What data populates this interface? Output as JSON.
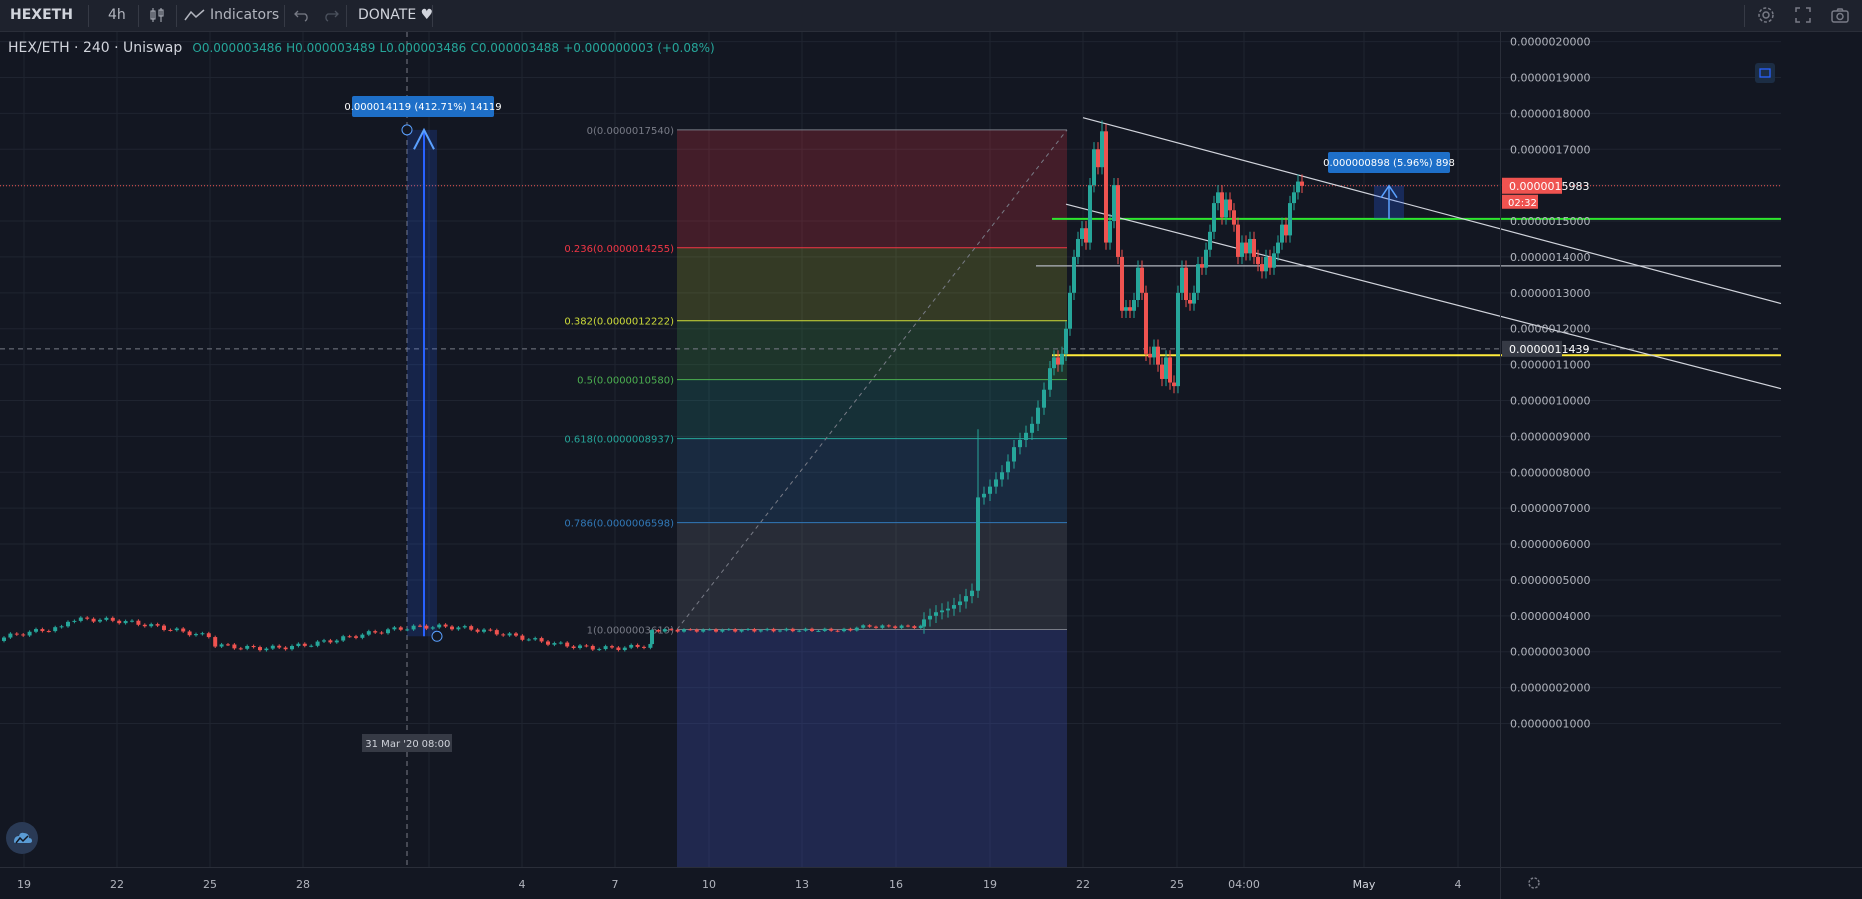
{
  "toolbar": {
    "symbol": "HEXETH",
    "interval": "4h",
    "indicators_label": "Indicators",
    "donate_label": "DONATE ♥",
    "undo_icon": "undo-icon",
    "redo_icon": "redo-icon",
    "settings_icon": "gear-icon",
    "fullscreen_icon": "fullscreen-icon",
    "snapshot_icon": "camera-icon"
  },
  "legend": {
    "title": "HEX/ETH · 240 · Uniswap",
    "open": "O0.000003486",
    "high": "H0.000003489",
    "low": "L0.000003486",
    "close": "C0.000003488",
    "change": "+0.000000003 (+0.08%)"
  },
  "price_axis": {
    "ticks": [
      "0.0000020000",
      "0.0000019000",
      "0.0000018000",
      "0.0000017000",
      "0.0000015000",
      "0.0000014000",
      "0.0000013000",
      "0.0000012000",
      "0.0000011000",
      "0.0000010000",
      "0.0000009000",
      "0.0000008000",
      "0.0000007000",
      "0.0000006000",
      "0.0000005000",
      "0.0000004000",
      "0.0000003000",
      "0.0000002000",
      "0.0000001000"
    ],
    "last_price": "0.0000015983",
    "countdown": "02:32",
    "crosshair_price": "0.0000011439"
  },
  "time_axis": {
    "ticks": [
      "19",
      "22",
      "25",
      "28",
      "4",
      "7",
      "10",
      "13",
      "16",
      "19",
      "22",
      "25",
      "04:00",
      "May",
      "4"
    ],
    "crosshair_date": "31 Mar '20",
    "crosshair_time": "08:00"
  },
  "measure_big": {
    "label": "0.000014119 (412.71%) 14119"
  },
  "measure_small": {
    "label": "0.000000898 (5.96%) 898"
  },
  "fib_levels": [
    {
      "label": "0(0.0000017540)",
      "color": "#787b86"
    },
    {
      "label": "0.236(0.0000014255)",
      "color": "#f23645"
    },
    {
      "label": "0.382(0.0000012222)",
      "color": "#cddc39"
    },
    {
      "label": "0.5(0.0000010580)",
      "color": "#4caf50"
    },
    {
      "label": "0.618(0.0000008937)",
      "color": "#26a69a"
    },
    {
      "label": "0.786(0.0000006598)",
      "color": "#3179b8"
    },
    {
      "label": "1(0.0000003619)",
      "color": "#787b86"
    }
  ],
  "colors": {
    "up": "#26a69a",
    "down": "#ef5350",
    "background": "#131722",
    "accent": "#2962ff"
  },
  "icons": {
    "logo": "tradingview-cloud-icon",
    "layout": "layout-icon",
    "axis_settings": "gear-icon"
  }
}
